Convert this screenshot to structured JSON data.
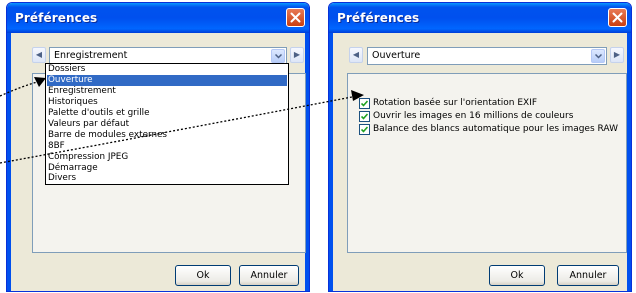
{
  "left_dialog": {
    "title": "Préférences",
    "combo_value": "Enregistrement",
    "dropdown_options": [
      "Dossiers",
      "Ouverture",
      "Enregistrement",
      "Historiques",
      "Palette d'outils et grille",
      "Valeurs par défaut",
      "Barre de modules externes",
      "8BF",
      "Compression JPEG",
      "Démarrage",
      "Divers"
    ],
    "selected_index": 1,
    "ok_label": "Ok",
    "cancel_label": "Annuler"
  },
  "right_dialog": {
    "title": "Préférences",
    "combo_value": "Ouverture",
    "checkboxes": [
      {
        "label": "Rotation basée sur l'orientation EXIF",
        "checked": true
      },
      {
        "label": "Ouvrir les images en 16 millions de couleurs",
        "checked": true
      },
      {
        "label": "Balance des blancs automatique pour les images RAW",
        "checked": true
      }
    ],
    "ok_label": "Ok",
    "cancel_label": "Annuler"
  },
  "icons": {
    "close": "close-icon",
    "prev": "chevron-left-icon",
    "next": "chevron-right-icon",
    "dropdown": "chevron-down-icon",
    "check": "checkmark-icon"
  },
  "colors": {
    "titlebar": "#0050ee",
    "selection": "#316ac5",
    "close_button": "#d2491d"
  }
}
